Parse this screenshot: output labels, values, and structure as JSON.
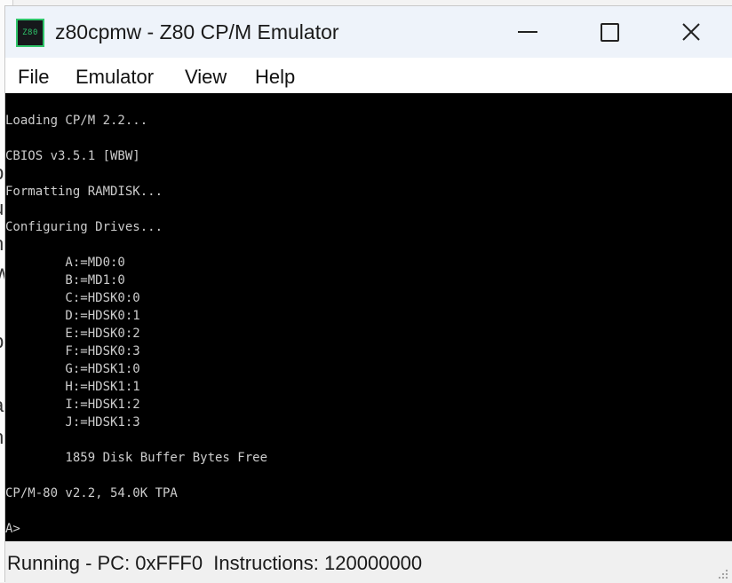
{
  "window": {
    "title": "z80cpmw - Z80 CP/M Emulator",
    "icon_label": "Z80"
  },
  "menu": {
    "items": [
      "File",
      "Emulator",
      "View",
      "Help"
    ]
  },
  "terminal": {
    "lines": [
      "Loading CP/M 2.2...",
      "",
      "CBIOS v3.5.1 [WBW]",
      "",
      "Formatting RAMDISK...",
      "",
      "Configuring Drives...",
      "",
      "        A:=MD0:0",
      "        B:=MD1:0",
      "        C:=HDSK0:0",
      "        D:=HDSK0:1",
      "        E:=HDSK0:2",
      "        F:=HDSK0:3",
      "        G:=HDSK1:0",
      "        H:=HDSK1:1",
      "        I:=HDSK1:2",
      "        J:=HDSK1:3",
      "",
      "        1859 Disk Buffer Bytes Free",
      "",
      "CP/M-80 v2.2, 54.0K TPA",
      "",
      "A>"
    ]
  },
  "status": {
    "text": "Running - PC: 0xFFF0  Instructions: 120000000"
  },
  "colors": {
    "terminal_bg": "#000000",
    "terminal_fg": "#cccccc",
    "titlebar_bg": "#eef3fa",
    "icon_accent": "#2fc56a"
  }
}
